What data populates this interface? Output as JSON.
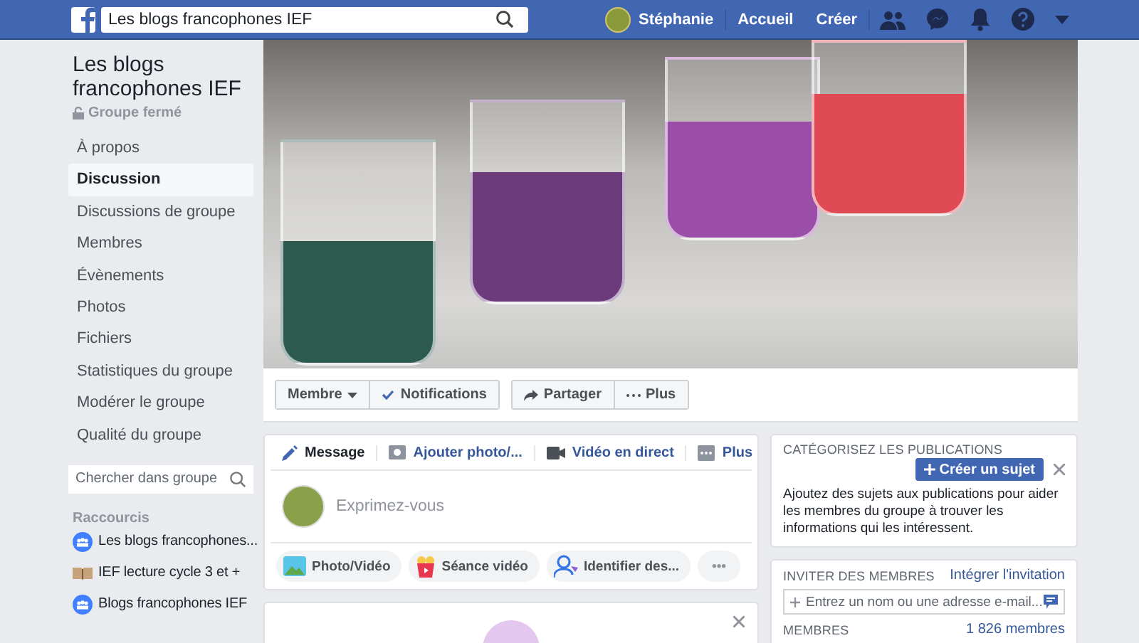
{
  "topbar": {
    "search": {
      "value": "Les blogs francophones IEF"
    },
    "user": "Stéphanie",
    "links": [
      "Accueil",
      "Créer"
    ]
  },
  "group": {
    "name": "Les blogs francophones IEF",
    "privacy": "Groupe fermé"
  },
  "nav": [
    {
      "label": "À propos",
      "selected": false
    },
    {
      "label": "Discussion",
      "selected": true
    },
    {
      "label": "Discussions de groupe",
      "selected": false
    },
    {
      "label": "Membres",
      "selected": false
    },
    {
      "label": "Évènements",
      "selected": false
    },
    {
      "label": "Photos",
      "selected": false
    },
    {
      "label": "Fichiers",
      "selected": false
    },
    {
      "label": "Statistiques du groupe",
      "selected": false
    },
    {
      "label": "Modérer le groupe",
      "selected": false
    },
    {
      "label": "Qualité du groupe",
      "selected": false
    }
  ],
  "group_search": {
    "placeholder": "Chercher dans groupe"
  },
  "shortcuts": {
    "title": "Raccourcis",
    "items": [
      {
        "label": "Les blogs francophones...",
        "kind": "group"
      },
      {
        "label": "IEF lecture cycle 3 et +",
        "kind": "book"
      },
      {
        "label": "Blogs francophones IEF",
        "kind": "group"
      }
    ]
  },
  "actions": [
    {
      "label": "Membre",
      "kind": "dropdown"
    },
    {
      "label": "Notifications",
      "kind": "check"
    },
    {
      "label": "Partager",
      "kind": "share"
    },
    {
      "label": "Plus",
      "kind": "more"
    }
  ],
  "composer": {
    "tabs": [
      {
        "label": "Message",
        "kind": "pencil",
        "selected": true
      },
      {
        "label": "Ajouter photo/...",
        "kind": "camera",
        "selected": false
      },
      {
        "label": "Vidéo en direct",
        "kind": "video",
        "selected": false
      },
      {
        "label": "Plus",
        "kind": "more",
        "selected": false
      }
    ],
    "placeholder": "Exprimez-vous",
    "buttons": [
      {
        "label": "Photo/Vidéo",
        "kind": "photo"
      },
      {
        "label": "Séance vidéo",
        "kind": "popcorn"
      },
      {
        "label": "Identifier des...",
        "kind": "tag"
      },
      {
        "label": "•••",
        "kind": "more"
      }
    ]
  },
  "categorize": {
    "title": "CATÉGORISEZ LES PUBLICATIONS",
    "button": "Créer un sujet",
    "text": "Ajoutez des sujets aux publications pour aider les membres du groupe à trouver les informations qui les intéressent."
  },
  "invite": {
    "title": "INVITER DES MEMBRES",
    "link": "Intégrer l'invitation",
    "placeholder": "Entrez un nom ou une adresse e-mail...",
    "members_label": "MEMBRES",
    "members_count": "1 826 membres"
  }
}
